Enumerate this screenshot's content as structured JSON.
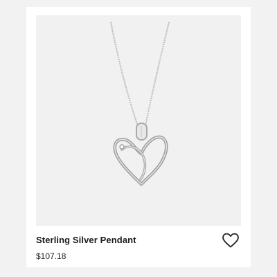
{
  "product": {
    "title": "Sterling Silver Pendant",
    "price": "$107.18",
    "image_alt": "heart pendant necklace",
    "favorite_icon": "heart-outline-icon"
  },
  "colors": {
    "page_background": "#f2f2f2",
    "card_background": "#ffffff",
    "image_background": "#f1f1f1",
    "text": "#1b1b1b"
  }
}
